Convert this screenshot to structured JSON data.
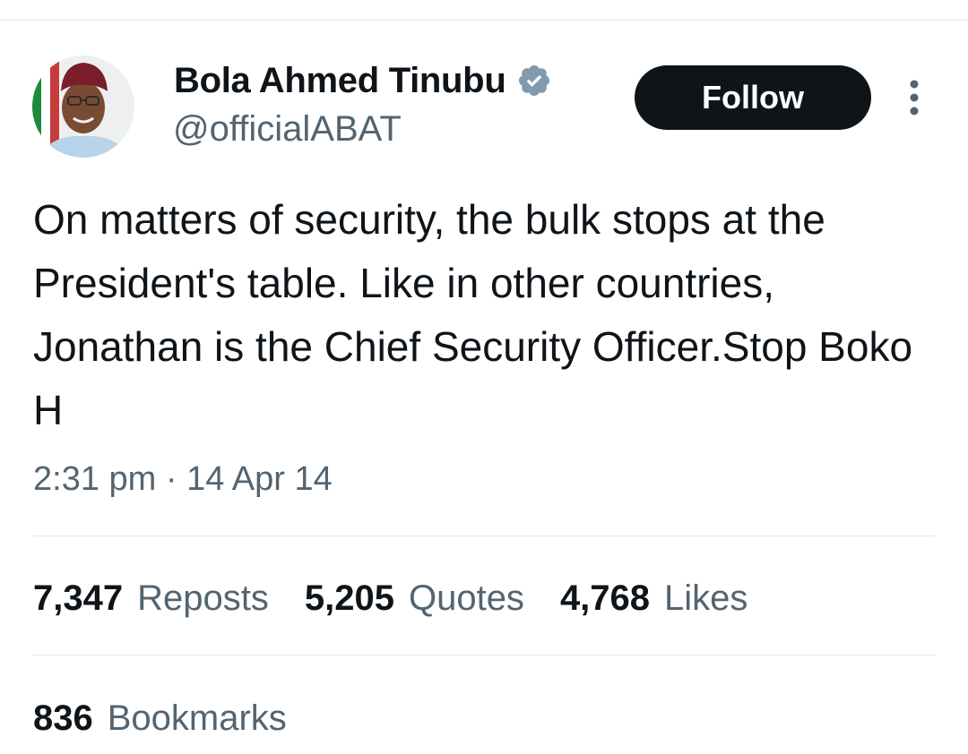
{
  "tweet": {
    "author": {
      "name": "Bola Ahmed Tinubu",
      "handle": "@officialABAT",
      "verified": true,
      "avatar_icon": "profile-photo"
    },
    "follow_label": "Follow",
    "more_icon": "more-vertical-icon",
    "text": "On matters of security, the bulk stops at the President's table. Like in other countries, Jonathan is the Chief Security Officer.Stop Boko H",
    "timestamp": "2:31 pm · 14 Apr 14",
    "stats": {
      "reposts_count": "7,347",
      "reposts_label": "Reposts",
      "quotes_count": "5,205",
      "quotes_label": "Quotes",
      "likes_count": "4,768",
      "likes_label": "Likes",
      "bookmarks_count": "836",
      "bookmarks_label": "Bookmarks"
    }
  },
  "colors": {
    "text_primary": "#0f1419",
    "text_secondary": "#536471",
    "divider": "#e3e7ea",
    "follow_bg": "#0f1419",
    "verified_badge": "#829aab"
  }
}
